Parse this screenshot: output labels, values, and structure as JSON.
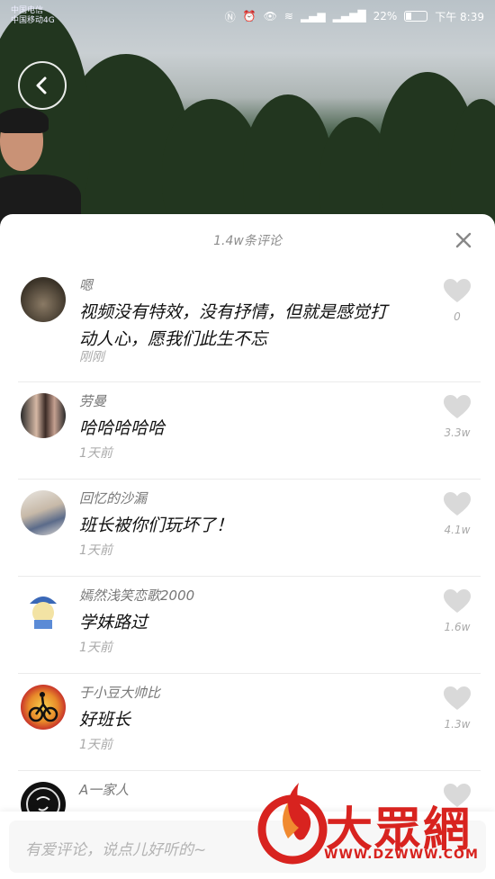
{
  "status_bar": {
    "carrier_1": "中国电信",
    "carrier_2": "中国移动4G",
    "battery": "22%",
    "time": "下午 8:39",
    "battery_level": 0.22
  },
  "sheet": {
    "title": "1.4w条评论"
  },
  "comments": [
    {
      "user": "嗯",
      "text": "视频没有特效，没有抒情，但就是感觉打动人心，愿我们此生不忘",
      "time": "刚刚",
      "likes": "0"
    },
    {
      "user": "劳曼",
      "text": "哈哈哈哈哈",
      "time": "1天前",
      "likes": "3.3w"
    },
    {
      "user": "回忆的沙漏",
      "text": "班长被你们玩坏了！",
      "time": "1天前",
      "likes": "4.1w"
    },
    {
      "user": "嫣然浅笑恋歌2000",
      "text": "学妹路过",
      "time": "1天前",
      "likes": "1.6w"
    },
    {
      "user": "于小豆大帅比",
      "text": "好班长",
      "time": "1天前",
      "likes": "1.3w"
    },
    {
      "user": "A一家人",
      "text": "",
      "time": "",
      "likes": ""
    }
  ],
  "input": {
    "placeholder": "有爱评论，说点儿好听的~"
  },
  "watermark": {
    "text": "大眾網",
    "url": "WWW.DZWWW.COM"
  },
  "colors": {
    "heart": "#d9d9d9",
    "watermark": "#d8231f"
  }
}
